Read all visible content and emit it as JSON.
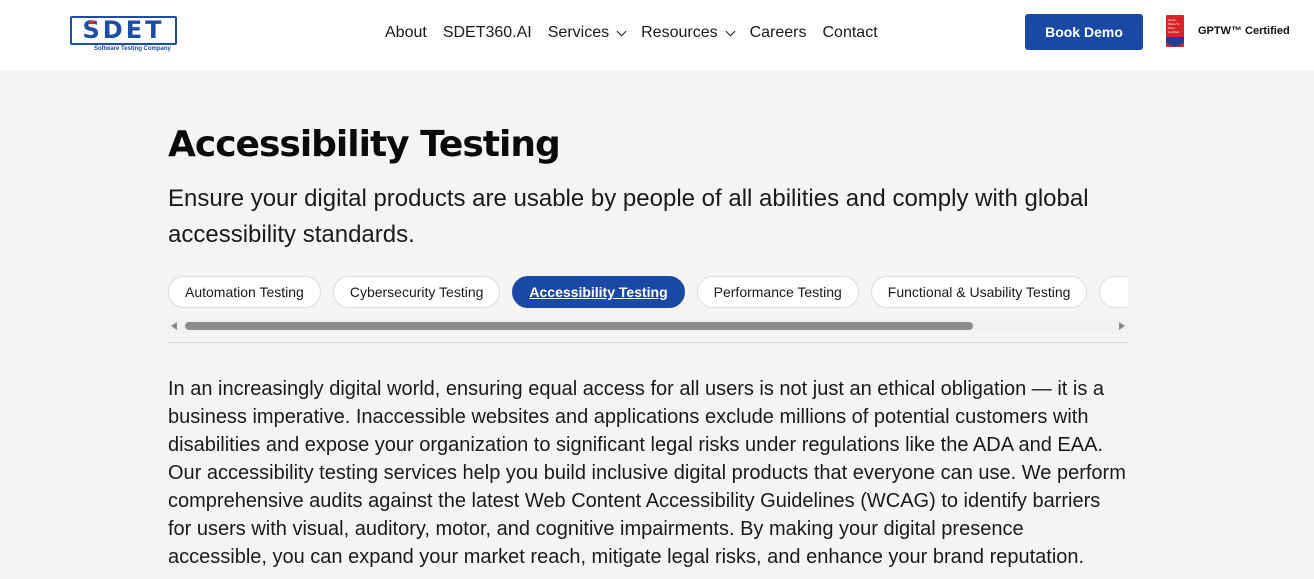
{
  "header": {
    "logo_text": "SDET",
    "logo_tagline": "Software Testing Company",
    "nav": [
      {
        "label": "About",
        "has_dropdown": false
      },
      {
        "label": "SDET360.AI",
        "has_dropdown": false
      },
      {
        "label": "Services",
        "has_dropdown": true
      },
      {
        "label": "Resources",
        "has_dropdown": true
      },
      {
        "label": "Careers",
        "has_dropdown": false
      },
      {
        "label": "Contact",
        "has_dropdown": false
      }
    ],
    "cta_label": "Book Demo",
    "badge_text": "Great Place To Work Certified",
    "certified_label": "GPTW™ Certified"
  },
  "main": {
    "title": "Accessibility Testing",
    "subtitle": "Ensure your digital products are usable by people of all abilities and comply with global accessibility standards.",
    "tabs": [
      {
        "label": "Automation Testing",
        "active": false
      },
      {
        "label": "Cybersecurity Testing",
        "active": false
      },
      {
        "label": "Accessibility Testing",
        "active": true
      },
      {
        "label": "Performance Testing",
        "active": false
      },
      {
        "label": "Functional & Usability Testing",
        "active": false
      },
      {
        "label": "",
        "active": false
      }
    ],
    "body": "In an increasingly digital world, ensuring equal access for all users is not just an ethical obligation — it is a business imperative. Inaccessible websites and applications exclude millions of potential customers with disabilities and expose your organization to significant legal risks under regulations like the ADA and EAA. Our accessibility testing services help you build inclusive digital products that everyone can use. We perform comprehensive audits against the latest Web Content Accessibility Guidelines (WCAG) to identify barriers for users with visual, auditory, motor, and cognitive impairments. By making your digital presence accessible, you can expand your market reach, mitigate legal risks, and enhance your brand reputation."
  },
  "colors": {
    "brand_blue": "#1a48a5",
    "page_bg": "#f5f4f2",
    "badge_red": "#d8232a"
  }
}
